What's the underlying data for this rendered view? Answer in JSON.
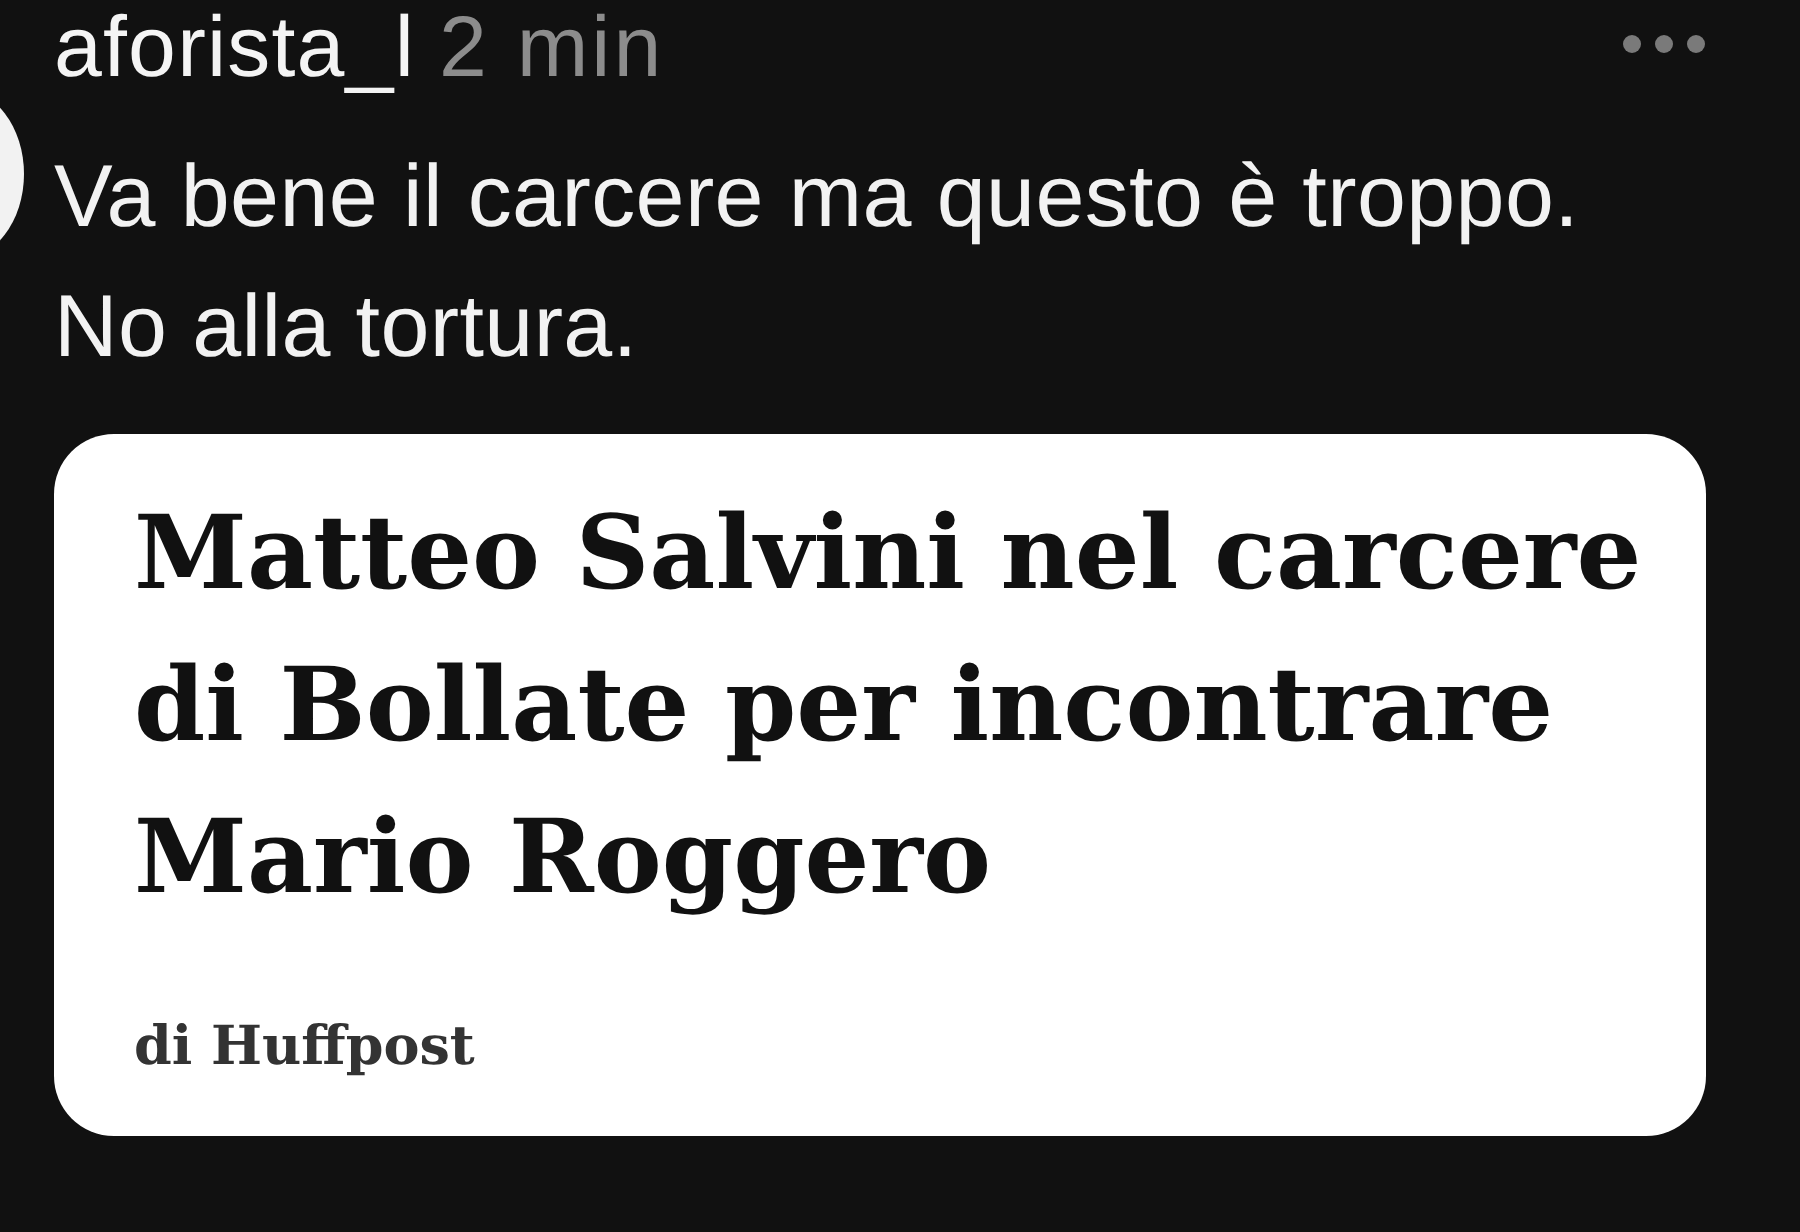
{
  "comment": {
    "author": "aforista_l",
    "time": "2 min",
    "text": "Va bene il carcere ma questo è troppo.\nNo alla tortura."
  },
  "link_card": {
    "title": "Matteo Salvini nel carcere di Bollate per incontrare Mario Roggero",
    "source": "di Huffpost"
  }
}
